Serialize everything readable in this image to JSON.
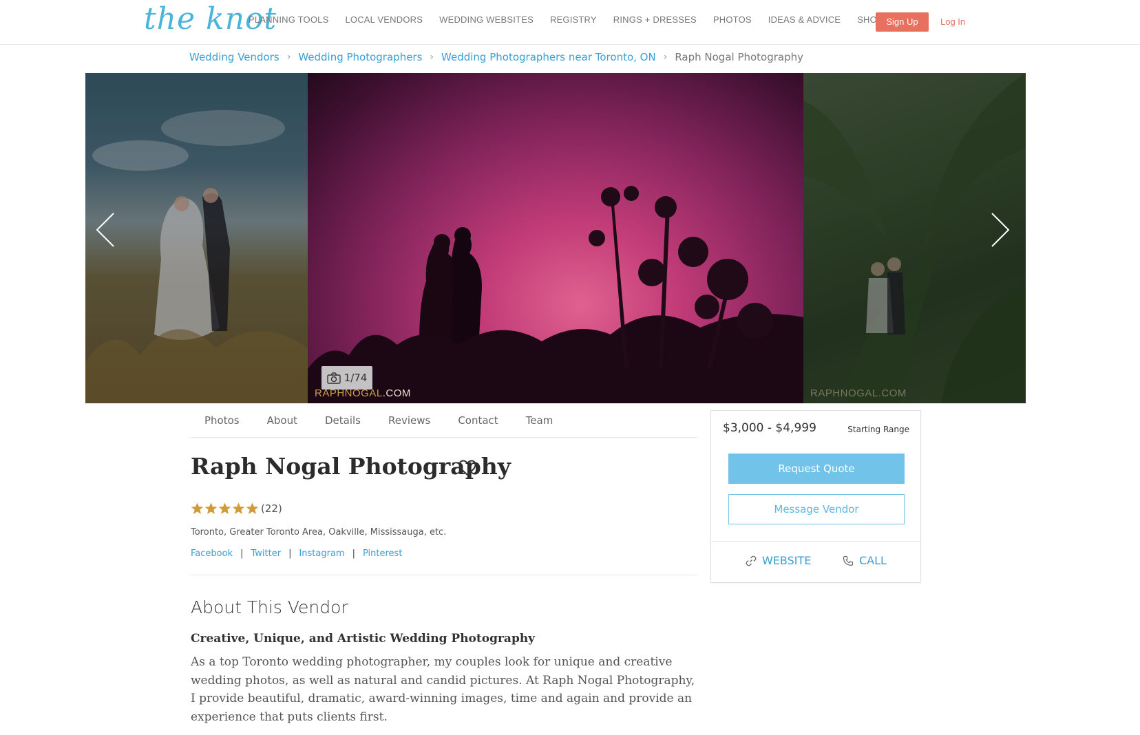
{
  "header": {
    "logo": "the knot",
    "nav": [
      "PLANNING TOOLS",
      "LOCAL VENDORS",
      "WEDDING WEBSITES",
      "REGISTRY",
      "RINGS + DRESSES",
      "PHOTOS",
      "IDEAS & ADVICE",
      "SHOP"
    ],
    "signup": "Sign Up",
    "login": "Log In"
  },
  "breadcrumb": {
    "items": [
      "Wedding Vendors",
      "Wedding Photographers",
      "Wedding Photographers near Toronto, ON"
    ],
    "separator": "›",
    "current": "Raph Nogal Photography"
  },
  "gallery": {
    "counter": "1/74",
    "watermark_brand": "RAPHNOGAL",
    "watermark_suffix": ".COM",
    "watermark_full": "RAPHNOGAL.COM"
  },
  "tabs": [
    "Photos",
    "About",
    "Details",
    "Reviews",
    "Contact",
    "Team"
  ],
  "vendor": {
    "name": "Raph Nogal Photography",
    "rating": 5,
    "review_count": "(22)",
    "location": "Toronto, Greater Toronto Area, Oakville, Mississauga, etc.",
    "social": [
      "Facebook",
      "Twitter",
      "Instagram",
      "Pinterest"
    ],
    "social_separator": "|"
  },
  "about": {
    "heading": "About This Vendor",
    "subheading": "Creative, Unique, and Artistic Wedding Photography",
    "body": "As a top Toronto wedding photographer, my couples look for unique and creative wedding photos, as well as natural and candid pictures. At Raph Nogal Photography, I provide beautiful, dramatic, award-winning images, time and again and provide an experience that puts clients first."
  },
  "quote_card": {
    "price": "$3,000 - $4,999",
    "price_label": "Starting Range",
    "request_quote": "Request Quote",
    "message_vendor": "Message Vendor",
    "website": "WEBSITE",
    "call": "CALL"
  },
  "colors": {
    "brand_blue": "#4ab4da",
    "link_blue": "#3a9fd1",
    "signup_coral": "#e8705f",
    "button_blue": "#71c3ea",
    "star_gold": "#d19a3c"
  },
  "icons": [
    "chevron-left-icon",
    "chevron-right-icon",
    "camera-icon",
    "heart-icon",
    "star-icon",
    "link-icon",
    "phone-icon"
  ]
}
